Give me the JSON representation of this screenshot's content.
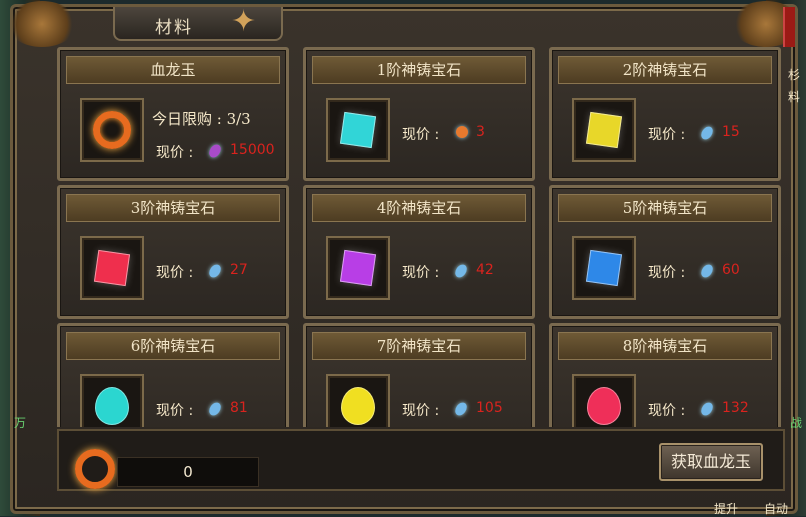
{
  "window": {
    "title": "材料"
  },
  "colors": {
    "price_text": "#d9231e",
    "accent_gold": "#7c6a4a"
  },
  "cards": [
    {
      "title": "血龙玉",
      "limit": "今日限购 : 3/3",
      "price_label": "现价 :",
      "price_value": "15000",
      "currency_icon": "purple-orb-icon",
      "item_icon": "blood-dragon-jade-icon"
    },
    {
      "title": "1阶神铸宝石",
      "price_label": "现价 :",
      "price_value": "3",
      "currency_icon": "blood-dragon-jade-icon",
      "item_icon": "cyan-gem-icon"
    },
    {
      "title": "2阶神铸宝石",
      "price_label": "现价 :",
      "price_value": "15",
      "currency_icon": "blue-crystal-icon",
      "item_icon": "yellow-gem-icon"
    },
    {
      "title": "3阶神铸宝石",
      "price_label": "现价 :",
      "price_value": "27",
      "currency_icon": "blue-crystal-icon",
      "item_icon": "red-gem-icon"
    },
    {
      "title": "4阶神铸宝石",
      "price_label": "现价 :",
      "price_value": "42",
      "currency_icon": "blue-crystal-icon",
      "item_icon": "purple-gem-icon"
    },
    {
      "title": "5阶神铸宝石",
      "price_label": "现价 :",
      "price_value": "60",
      "currency_icon": "blue-crystal-icon",
      "item_icon": "blue-gem-icon"
    },
    {
      "title": "6阶神铸宝石",
      "price_label": "现价 :",
      "price_value": "81",
      "currency_icon": "blue-crystal-icon",
      "item_icon": "cyan-egg-gem-icon"
    },
    {
      "title": "7阶神铸宝石",
      "price_label": "现价 :",
      "price_value": "105",
      "currency_icon": "blue-crystal-icon",
      "item_icon": "yellow-egg-gem-icon"
    },
    {
      "title": "8阶神铸宝石",
      "price_label": "现价 :",
      "price_value": "132",
      "currency_icon": "blue-crystal-icon",
      "item_icon": "red-egg-gem-icon"
    }
  ],
  "footer": {
    "count": "0",
    "get_button": "获取血龙玉",
    "count_icon": "blood-dragon-jade-icon"
  },
  "side": {
    "right_top": "杉",
    "right_mid": "料",
    "left_label": "万",
    "right_label": "战",
    "bottom_left": "提升",
    "bottom_right": "自动"
  }
}
